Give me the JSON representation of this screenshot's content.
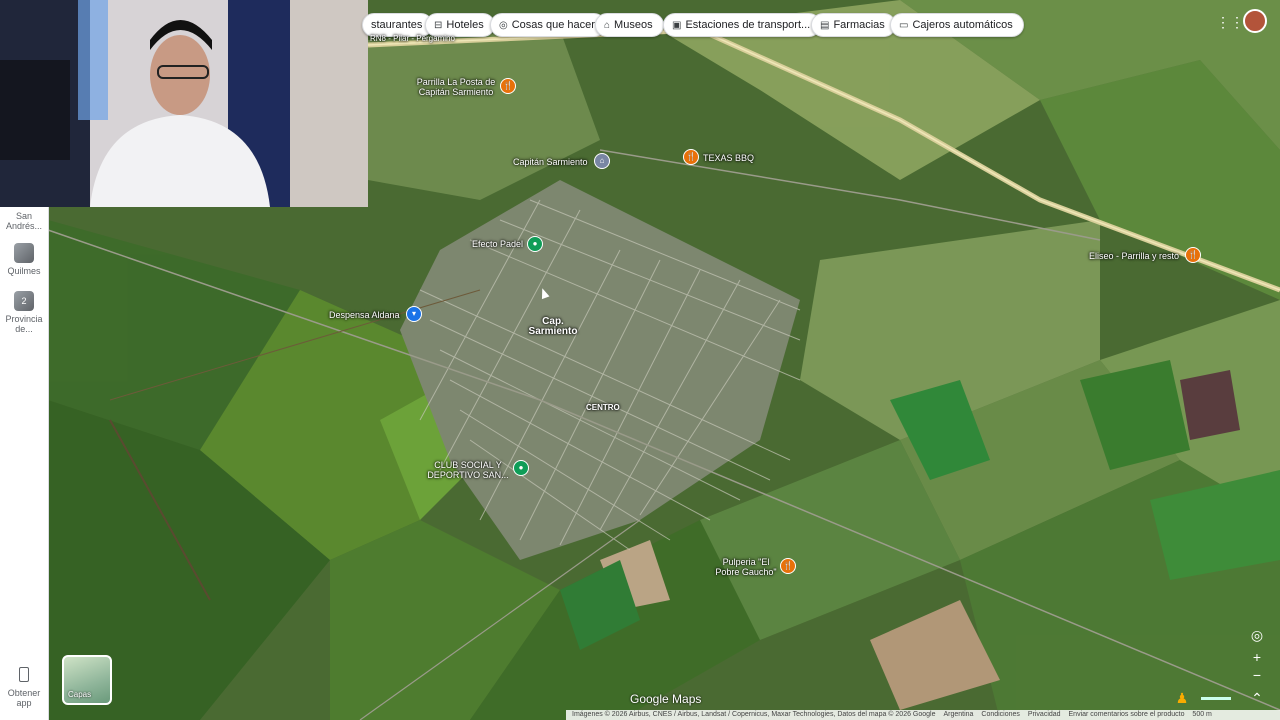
{
  "filter_chips": [
    {
      "icon": "restaurant-icon",
      "label": "staurantes"
    },
    {
      "icon": "bed-icon",
      "label": "Hoteles"
    },
    {
      "icon": "camera-icon",
      "label": "Cosas que hacer"
    },
    {
      "icon": "museum-icon",
      "label": "Museos"
    },
    {
      "icon": "transit-icon",
      "label": "Estaciones de transport..."
    },
    {
      "icon": "pharmacy-icon",
      "label": "Farmacias"
    },
    {
      "icon": "atm-icon",
      "label": "Cajeros automáticos"
    }
  ],
  "sidebar": {
    "recents": [
      {
        "label": "San Andrés..."
      },
      {
        "label": "Quilmes"
      },
      {
        "label": "Provincia de...",
        "badge": "2"
      }
    ],
    "get_app": "Obtener app"
  },
  "road_label": "RN8 - Pilar - Pergamino",
  "places": {
    "parrilla_posta": "Parrilla La Posta de Capitán Sarmiento",
    "capitan_sarmiento_poi": "Capitán Sarmiento",
    "texas_bbq": "TEXAS BBQ",
    "efecto_padel": "Efecto Padel",
    "despensa_aldana": "Despensa Aldana",
    "town": "Cap. Sarmiento",
    "centro": "CENTRO",
    "club": "CLUB SOCIAL Y DEPORTIVO SAN...",
    "eliseo": "Eliseo - Parrilla y resto",
    "pulperia": "Pulperia \"El Pobre Gaucho\""
  },
  "layers_label": "Capas",
  "wordmark": "Google Maps",
  "footer": {
    "attribution": "Imágenes © 2026 Airbus, CNES / Airbus, Landsat / Copernicus, Maxar Technologies, Datos del mapa © 2026 Google",
    "country": "Argentina",
    "terms": "Condiciones",
    "privacy": "Privacidad",
    "feedback": "Enviar comentarios sobre el producto",
    "scale": "500 m"
  },
  "colors": {
    "food_pin": "#e8710a",
    "park_pin": "#0f9d58",
    "shop_pin": "#1a73e8"
  }
}
